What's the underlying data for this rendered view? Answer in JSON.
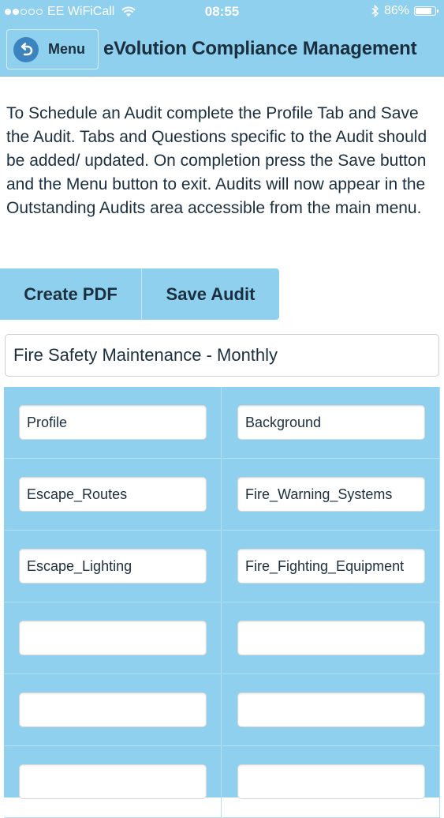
{
  "status_bar": {
    "carrier": "EE WiFiCall",
    "time": "08:55",
    "battery": "86%",
    "battery_level": 0.86,
    "signal_bars_filled": 2,
    "signal_bars_total": 5
  },
  "nav": {
    "menu_label": "Menu",
    "title": "eVolution Compliance Management"
  },
  "instructions": "To Schedule an Audit complete the Profile Tab and Save the Audit. Tabs and Questions specific to the Audit should be added/ updated. On completion press the Save button and the Menu button to exit. Audits will now appear in the Outstanding Audits area accessible from the main menu.",
  "actions": {
    "create_pdf": "Create PDF",
    "save_audit": "Save Audit"
  },
  "audit_name": "Fire Safety Maintenance - Monthly",
  "tabs": [
    [
      "Profile",
      "Background"
    ],
    [
      "Escape_Routes",
      "Fire_Warning_Systems"
    ],
    [
      "Escape_Lighting",
      "Fire_Fighting_Equipment"
    ],
    [
      "",
      ""
    ],
    [
      "",
      ""
    ],
    [
      "",
      ""
    ]
  ],
  "colors": {
    "accent": "#8ed0ee",
    "text": "#1b2f3f",
    "back_icon": "#3b84c0"
  },
  "icons": [
    "back-arrow-icon",
    "wifi-icon",
    "bluetooth-icon",
    "battery-icon"
  ]
}
